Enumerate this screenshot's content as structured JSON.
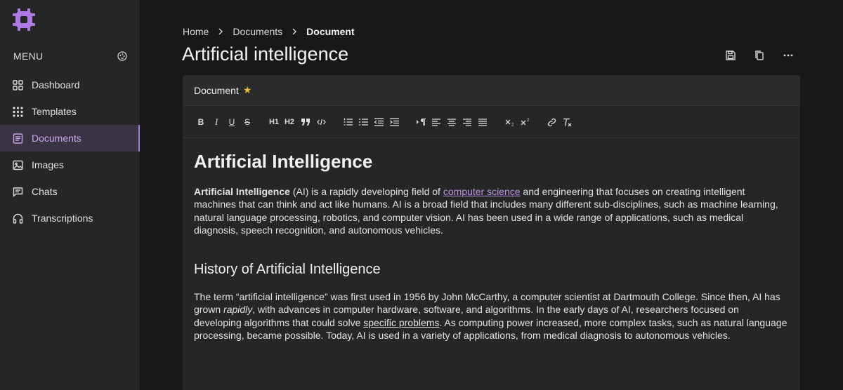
{
  "sidebar": {
    "menu_title": "MENU",
    "items": [
      {
        "label": "Dashboard",
        "icon": "grid-icon",
        "active": false
      },
      {
        "label": "Templates",
        "icon": "dots-grid-icon",
        "active": false
      },
      {
        "label": "Documents",
        "icon": "document-icon",
        "active": true
      },
      {
        "label": "Images",
        "icon": "image-icon",
        "active": false
      },
      {
        "label": "Chats",
        "icon": "chat-icon",
        "active": false
      },
      {
        "label": "Transcriptions",
        "icon": "headphones-icon",
        "active": false
      }
    ]
  },
  "breadcrumb": {
    "items": [
      "Home",
      "Documents",
      "Document"
    ]
  },
  "page": {
    "title": "Artificial intelligence"
  },
  "editor": {
    "doc_label": "Document",
    "toolbar": [
      "B",
      "I",
      "U",
      "S",
      "H1",
      "H2",
      "quote",
      "code",
      "ordered-list",
      "bullet-list",
      "outdent",
      "indent",
      "paragraph",
      "align-left",
      "align-center",
      "align-right",
      "justify",
      "subscript",
      "superscript",
      "link",
      "clear-format"
    ],
    "content": {
      "h1": "Artificial Intelligence",
      "p1_bold": "Artificial Intelligence",
      "p1_a": " (AI) is a rapidly developing field of ",
      "p1_link": "computer science",
      "p1_b": " and engineering that focuses on creating intelligent machines that can think and act like humans. AI is a broad field that includes many different sub-disciplines, such as machine learning, natural language processing, robotics, and computer vision. AI has been used in a wide range of applications, such as medical diagnosis, speech recognition, and autonomous vehicles.",
      "h2": "History of Artificial Intelligence",
      "p2_a": "The term “artificial intelligence” was first used in 1956 by John McCarthy, a computer scientist at Dartmouth College. Since then, AI has grown ",
      "p2_italic": "rapidly",
      "p2_b": ", with advances in computer hardware, software, and algorithms. In the early days of AI, researchers focused on developing algorithms that could solve ",
      "p2_underline": "specific problems",
      "p2_c": ". As computing power increased, more complex tasks, such as natural language processing, became possible. Today, AI is used in a variety of applications, from medical diagnosis to autonomous vehicles."
    }
  },
  "colors": {
    "accent": "#a57bd9",
    "link": "#b896e6",
    "star": "#f5b82e",
    "background": "#181818",
    "sidebar": "#262626"
  }
}
